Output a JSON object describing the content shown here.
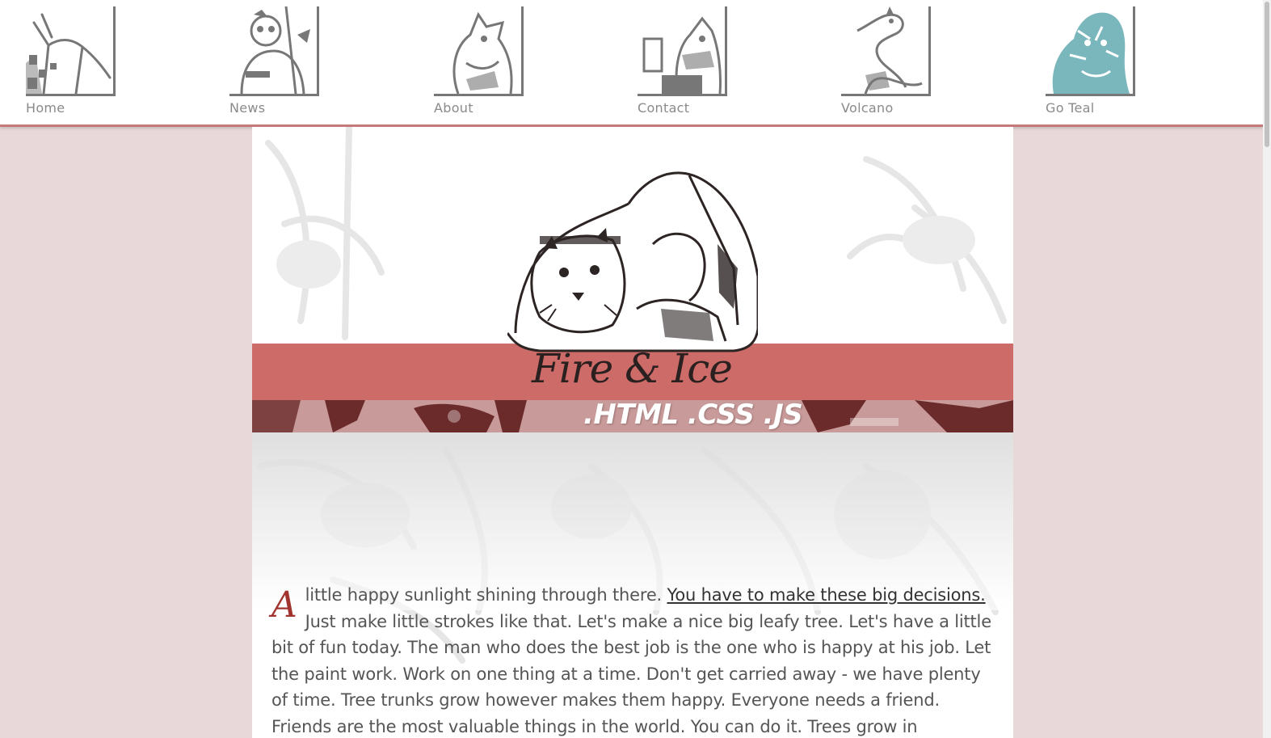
{
  "nav": {
    "items": [
      {
        "label": "Home",
        "icon": "giraffe-icon",
        "tint": "#777777"
      },
      {
        "label": "News",
        "icon": "warrior-bear-icon",
        "tint": "#777777"
      },
      {
        "label": "About",
        "icon": "dog-icon",
        "tint": "#777777"
      },
      {
        "label": "Contact",
        "icon": "pig-drinking-icon",
        "tint": "#777777"
      },
      {
        "label": "Volcano",
        "icon": "lizard-icon",
        "tint": "#777777"
      },
      {
        "label": "Go Teal",
        "icon": "tiger-icon",
        "tint": "#7ab7bd"
      }
    ]
  },
  "hero": {
    "title": "Fire & Ice",
    "subtitle": ".HTML .CSS .JS",
    "art": "tiger-warrior-icon"
  },
  "article": {
    "dropcap": "A",
    "lead": " little happy sunlight shining through there. ",
    "link_text": "You have to make these big decisions.",
    "body": " Just make little strokes like that. Let's make a nice big leafy tree. Let's have a little bit of fun today. The man who does the best job is the one who is happy at his job. Let the paint work. Work on one thing at a time. Don't get carried away - we have plenty of time. Tree trunks grow however makes them happy. Everyone needs a friend. Friends are the most valuable things in the world. You can do it. Trees grow in"
  },
  "colors": {
    "page_bg": "#e8d8d9",
    "accent_red": "#cc6b67",
    "strip": "#c89a99",
    "nav_border": "#c47a78",
    "teal": "#7ab7bd",
    "dropcap": "#a2342f"
  }
}
